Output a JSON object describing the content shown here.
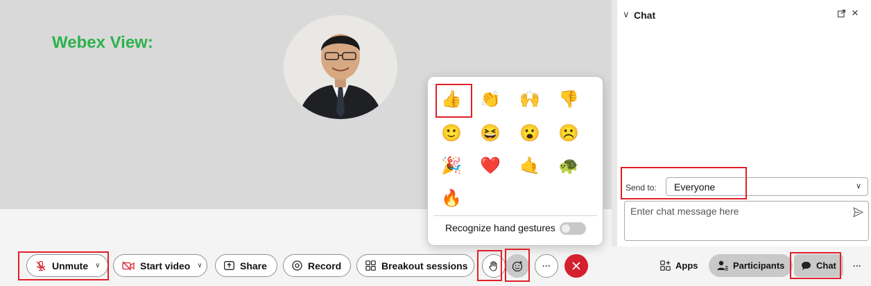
{
  "stage": {
    "label": "Webex View:"
  },
  "chat": {
    "title": "Chat",
    "send_to_label": "Send to:",
    "send_to_value": "Everyone",
    "input_placeholder": "Enter chat message here"
  },
  "reactions": {
    "emojis": [
      "👍",
      "👏",
      "🙌",
      "👎",
      "🙂",
      "😆",
      "😮",
      "☹️",
      "🎉",
      "❤️",
      "🤙",
      "🐢",
      "🔥"
    ],
    "selected_index": 0,
    "gesture_label": "Recognize hand gestures",
    "gesture_enabled": false
  },
  "toolbar": {
    "unmute": "Unmute",
    "start_video": "Start video",
    "share": "Share",
    "record": "Record",
    "breakout": "Breakout sessions",
    "apps": "Apps",
    "participants": "Participants",
    "chat": "Chat",
    "more": "···"
  },
  "colors": {
    "accent_green": "#2bb24c",
    "leave_red": "#d4202f",
    "highlight_red": "#e01f26"
  }
}
